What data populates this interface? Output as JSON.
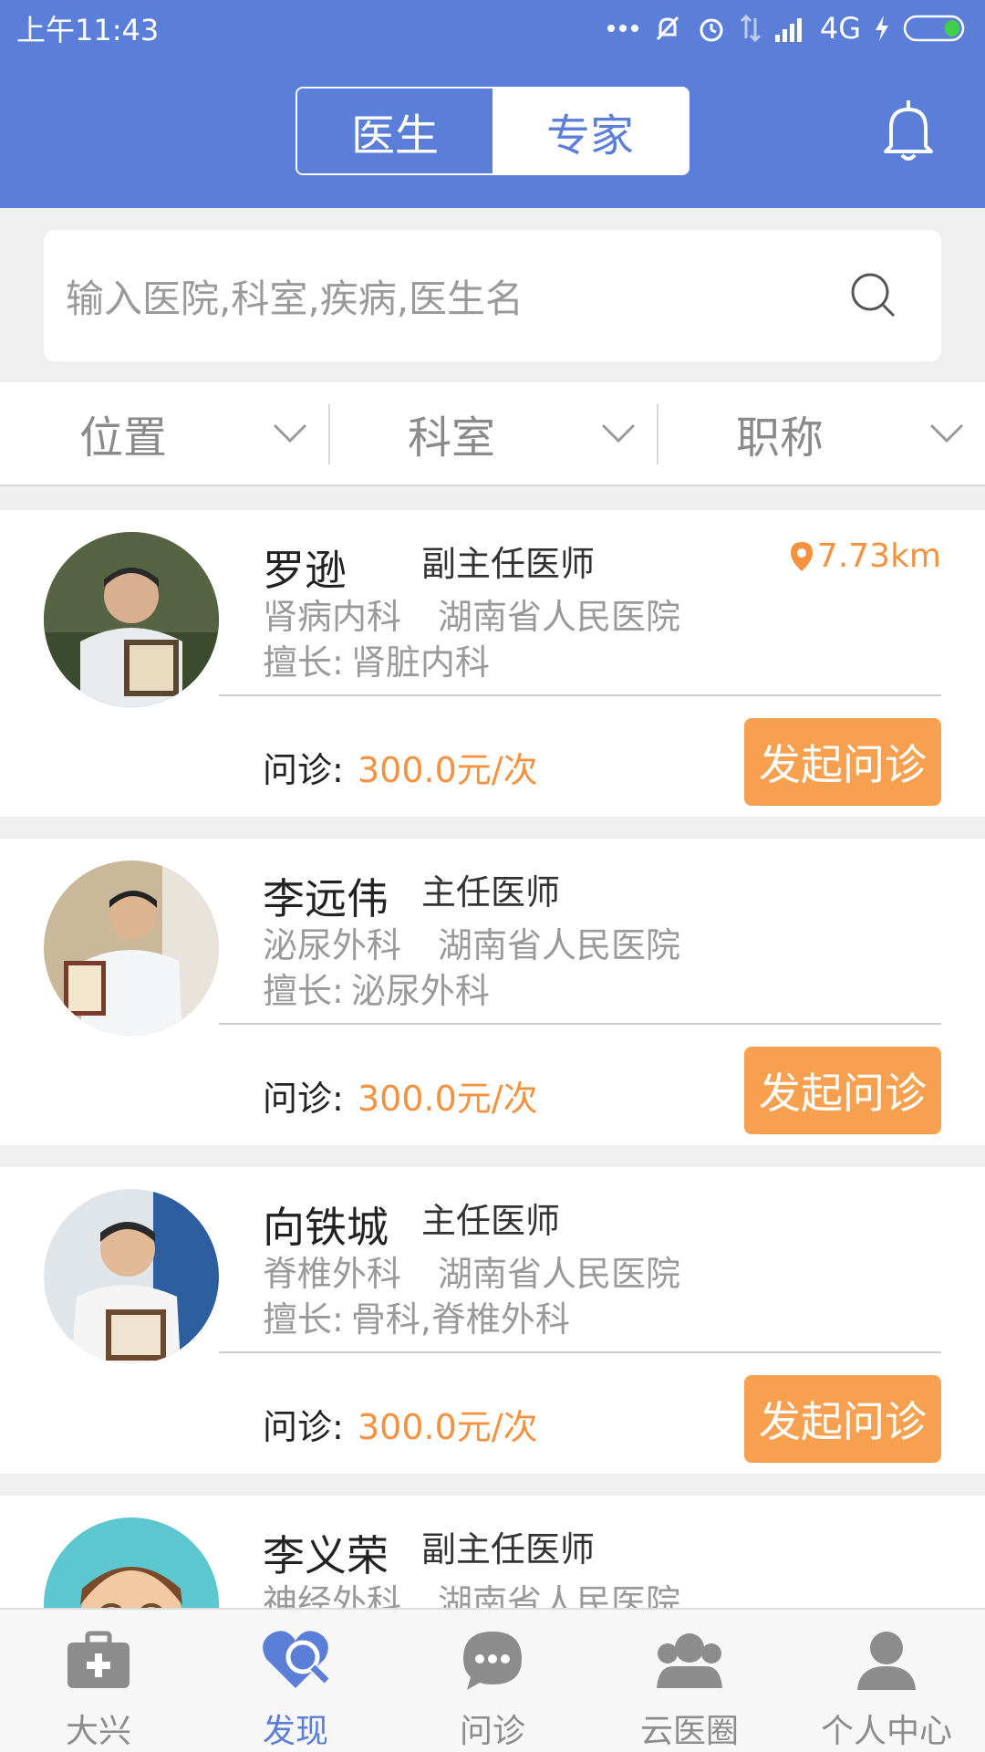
{
  "status_bar": {
    "time": "上午11:43",
    "network": "4G"
  },
  "header": {
    "tabs": [
      {
        "label": "医生",
        "active": true
      },
      {
        "label": "专家",
        "active": false
      }
    ]
  },
  "search": {
    "placeholder": "输入医院,科室,疾病,医生名"
  },
  "filters": [
    {
      "label": "位置"
    },
    {
      "label": "科室"
    },
    {
      "label": "职称"
    }
  ],
  "doctors": [
    {
      "name": "罗逊",
      "title": "副主任医师",
      "distance": "7.73km",
      "department": "肾病内科",
      "hospital": "湖南省人民医院",
      "specialty_label": "擅长:",
      "specialty": "肾脏内科",
      "fee_label": "问诊:",
      "fee": "300.0元/次",
      "button": "发起问诊"
    },
    {
      "name": "李远伟",
      "title": "主任医师",
      "distance": "",
      "department": "泌尿外科",
      "hospital": "湖南省人民医院",
      "specialty_label": "擅长:",
      "specialty": "泌尿外科",
      "fee_label": "问诊:",
      "fee": "300.0元/次",
      "button": "发起问诊"
    },
    {
      "name": "向铁城",
      "title": "主任医师",
      "distance": "",
      "department": "脊椎外科",
      "hospital": "湖南省人民医院",
      "specialty_label": "擅长:",
      "specialty": "骨科,脊椎外科",
      "fee_label": "问诊:",
      "fee": "300.0元/次",
      "button": "发起问诊"
    },
    {
      "name": "李义荣",
      "title": "副主任医师",
      "distance": "",
      "department": "神经外科",
      "hospital": "湖南省人民医院",
      "specialty_label": "",
      "specialty": "",
      "fee_label": "",
      "fee": "",
      "button": ""
    }
  ],
  "bottom_nav": [
    {
      "label": "大兴",
      "icon": "medkit-icon",
      "active": false
    },
    {
      "label": "发现",
      "icon": "discover-icon",
      "active": true
    },
    {
      "label": "问诊",
      "icon": "chat-icon",
      "active": false
    },
    {
      "label": "云医圈",
      "icon": "group-icon",
      "active": false
    },
    {
      "label": "个人中心",
      "icon": "user-icon",
      "active": false
    }
  ],
  "colors": {
    "primary": "#5b7fd9",
    "accent": "#f5913f",
    "button": "#f7a050"
  }
}
